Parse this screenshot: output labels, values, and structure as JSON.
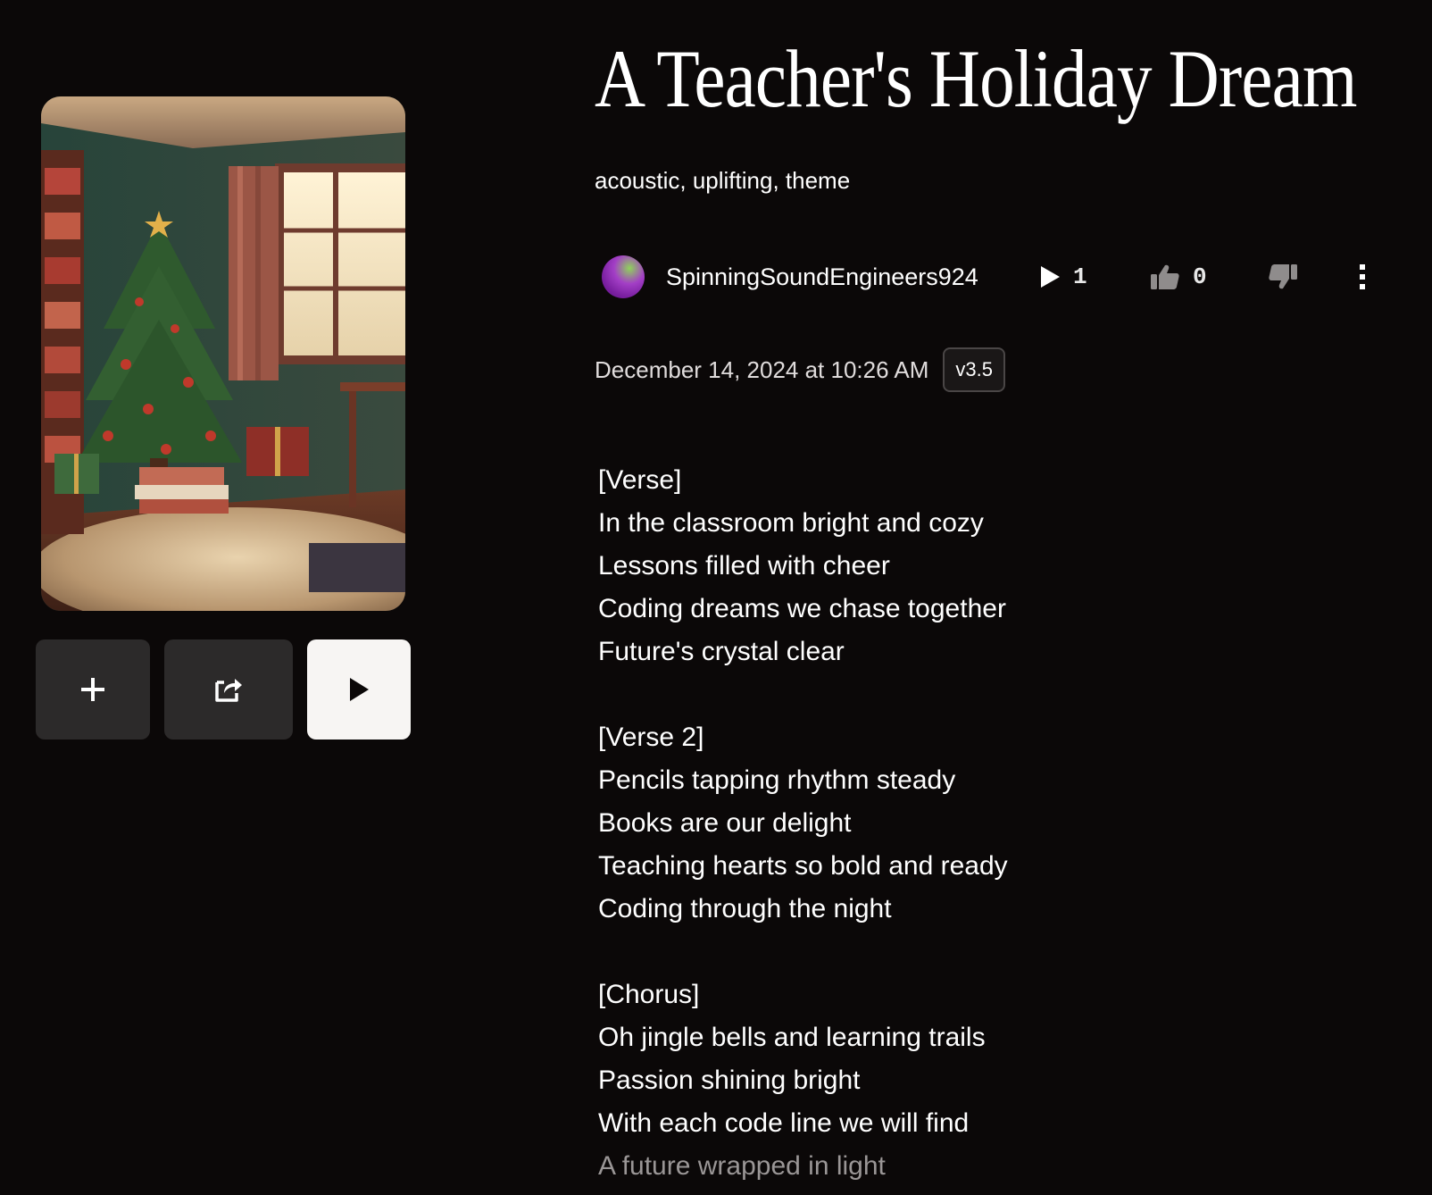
{
  "song": {
    "title": "A Teacher's Holiday Dream",
    "tags": "acoustic, uplifting, theme",
    "creator": "SpinningSoundEngineers924",
    "plays": "1",
    "likes": "0",
    "date": "December 14, 2024 at 10:26 AM",
    "version": "v3.5"
  },
  "icons": {
    "add": "plus-icon",
    "share": "share-icon",
    "play": "play-icon",
    "plays": "play-count-icon",
    "likes": "thumbs-up-icon",
    "dislike": "thumbs-down-icon",
    "more": "more-vertical-icon"
  },
  "lyrics": {
    "verse1": {
      "header": "[Verse]",
      "lines": [
        "In the classroom bright and cozy",
        "Lessons filled with cheer",
        "Coding dreams we chase together",
        "Future's crystal clear"
      ]
    },
    "verse2": {
      "header": "[Verse 2]",
      "lines": [
        "Pencils tapping rhythm steady",
        "Books are our delight",
        "Teaching hearts so bold and ready",
        "Coding through the night"
      ]
    },
    "chorus": {
      "header": "[Chorus]",
      "lines": [
        "Oh jingle bells and learning trails",
        "Passion shining bright",
        "With each code line we will find",
        "A future wrapped in light"
      ]
    }
  }
}
